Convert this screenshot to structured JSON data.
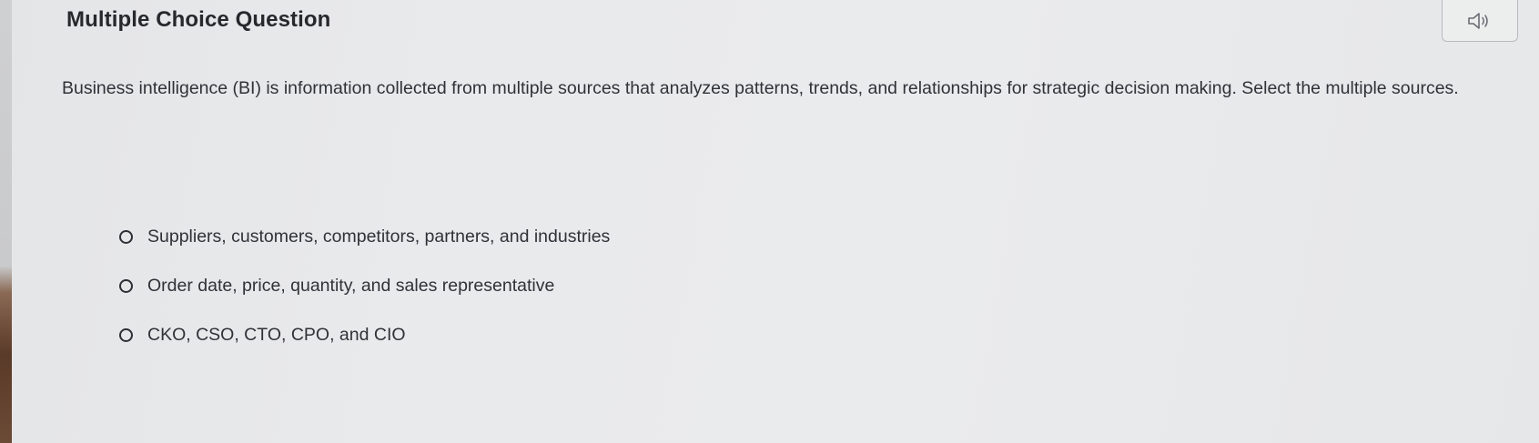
{
  "question": {
    "title": "Multiple Choice Question",
    "text": "Business intelligence (BI) is information collected from multiple sources that analyzes patterns, trends, and relationships for strategic decision making. Select the multiple sources."
  },
  "audio_button": {
    "icon": "speaker-icon"
  },
  "choices": [
    {
      "label": "Suppliers, customers, competitors, partners, and industries",
      "selected": false
    },
    {
      "label": "Order date, price, quantity, and sales representative",
      "selected": false
    },
    {
      "label": "CKO, CSO, CTO, CPO, and CIO",
      "selected": false
    }
  ]
}
